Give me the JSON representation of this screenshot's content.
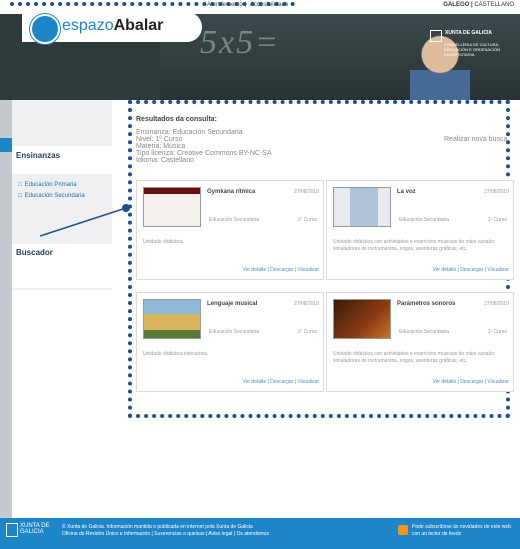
{
  "header": {
    "top_links": [
      "Atendemento",
      "Accesibilidade"
    ],
    "langs": [
      "GALEGO",
      "CASTELLANO"
    ],
    "logo_left": "espazo",
    "logo_right": "Abalar",
    "board_text": "5x5=",
    "xunta_title": "XUNTA DE GALICIA",
    "xunta_sub": "CONSELLERIA DE CULTURA, EDUCACIÓN E ORDENACIÓN UNIVERSITARIA"
  },
  "nav": {
    "section1": "Ensinanzas",
    "items": [
      "Educación Primaria",
      "Educación Secundaria"
    ],
    "section2": "Buscador"
  },
  "results": {
    "title": "Resultados da consulta:",
    "info": [
      "Ensinanza: Educación Secundaria",
      "Nivel: 1º Curso",
      "Materia: Música",
      "Tipo licenza: Creative Commons BY-NC-SA",
      "Idioma: Castellano"
    ],
    "new_search": "Realizar nova busca",
    "cards": [
      {
        "title": "Gymkana rítmica",
        "date": "27/08/2010",
        "level": "Educación Secundaria",
        "course": "1º Curso",
        "desc": "Unidade didáctica.",
        "links": [
          "Ver detalle",
          "Descargar",
          "Visualizar"
        ],
        "thumb_color": "#6a0e0e"
      },
      {
        "title": "La voz",
        "date": "27/08/2010",
        "level": "Educación Secundaria",
        "course": "1º Curso",
        "desc": "Unidade didáctica con actividades e exercicios musicais do máis variado: simuladores de instrumentos, xogos, aventuras gráficas, etc.",
        "links": [
          "Ver detalle",
          "Descargar",
          "Visualizar"
        ],
        "thumb_color": "#b0c4d8"
      },
      {
        "title": "Lenguaje musical",
        "date": "27/08/2010",
        "level": "Educación Secundaria",
        "course": "1º Curso",
        "desc": "Unidade didáctica interactiva.",
        "links": [
          "Ver detalle",
          "Descargar",
          "Visualizar"
        ],
        "thumb_color": "#d9b45a"
      },
      {
        "title": "Parámetros sonoros",
        "date": "27/08/2010",
        "level": "Educación Secundaria",
        "course": "1º Curso",
        "desc": "Unidade didáctica con actividades e exercicios musicais do máis variado: simuladores de instrumentos, xogos, aventuras gráficas, etc.",
        "links": [
          "Ver detalle",
          "Descargar",
          "Visualizar"
        ],
        "thumb_color": "#8a3b12"
      }
    ]
  },
  "footer": {
    "logo": "XUNTA DE GALICIA",
    "line1": "© Xunta de Galicia. Información mantida e publicada en internet pola Xunta de Galicia",
    "line2": "Oficina de Rexistro Único e Información | Suxerencias e queixas | Aviso legal | Os atendemos",
    "rss": "Pode subscribirse ás novidades de este web con un lector de feeds"
  },
  "colors": {
    "accent": "#1d86c8",
    "annotation": "#1d4f8f"
  }
}
